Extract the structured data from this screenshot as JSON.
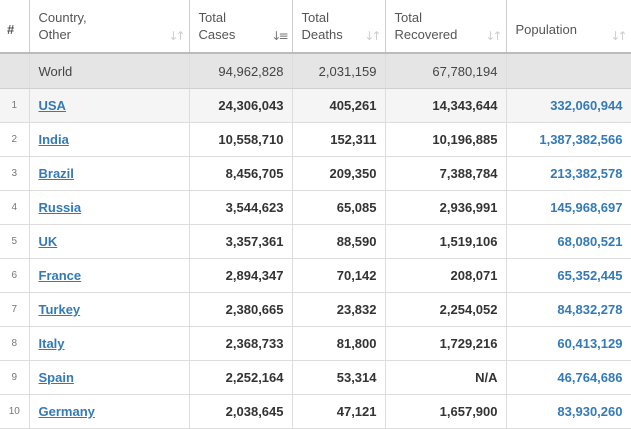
{
  "table": {
    "headers": {
      "rank": "#",
      "country": "Country,\nOther",
      "total_cases": "Total\nCases",
      "total_deaths": "Total\nDeaths",
      "total_recovered": "Total\nRecovered",
      "population": "Population"
    },
    "sort_icons": {
      "default": "↓↑",
      "active": "↓≡"
    },
    "world": {
      "country": "World",
      "total_cases": "94,962,828",
      "total_deaths": "2,031,159",
      "total_recovered": "67,780,194",
      "population": ""
    },
    "rows": [
      {
        "rank": "1",
        "country": "USA",
        "total_cases": "24,306,043",
        "total_deaths": "405,261",
        "total_recovered": "14,343,644",
        "population": "332,060,944"
      },
      {
        "rank": "2",
        "country": "India",
        "total_cases": "10,558,710",
        "total_deaths": "152,311",
        "total_recovered": "10,196,885",
        "population": "1,387,382,566"
      },
      {
        "rank": "3",
        "country": "Brazil",
        "total_cases": "8,456,705",
        "total_deaths": "209,350",
        "total_recovered": "7,388,784",
        "population": "213,382,578"
      },
      {
        "rank": "4",
        "country": "Russia",
        "total_cases": "3,544,623",
        "total_deaths": "65,085",
        "total_recovered": "2,936,991",
        "population": "145,968,697"
      },
      {
        "rank": "5",
        "country": "UK",
        "total_cases": "3,357,361",
        "total_deaths": "88,590",
        "total_recovered": "1,519,106",
        "population": "68,080,521"
      },
      {
        "rank": "6",
        "country": "France",
        "total_cases": "2,894,347",
        "total_deaths": "70,142",
        "total_recovered": "208,071",
        "population": "65,352,445"
      },
      {
        "rank": "7",
        "country": "Turkey",
        "total_cases": "2,380,665",
        "total_deaths": "23,832",
        "total_recovered": "2,254,052",
        "population": "84,832,278"
      },
      {
        "rank": "8",
        "country": "Italy",
        "total_cases": "2,368,733",
        "total_deaths": "81,800",
        "total_recovered": "1,729,216",
        "population": "60,413,129"
      },
      {
        "rank": "9",
        "country": "Spain",
        "total_cases": "2,252,164",
        "total_deaths": "53,314",
        "total_recovered": "N/A",
        "population": "46,764,686"
      },
      {
        "rank": "10",
        "country": "Germany",
        "total_cases": "2,038,645",
        "total_deaths": "47,121",
        "total_recovered": "1,657,900",
        "population": "83,930,260"
      }
    ]
  },
  "colors": {
    "link": "#337ab7",
    "world_row_bg": "#e5e5e5",
    "highlight_row_bg": "#f5f5f5",
    "border": "#dddddd"
  }
}
